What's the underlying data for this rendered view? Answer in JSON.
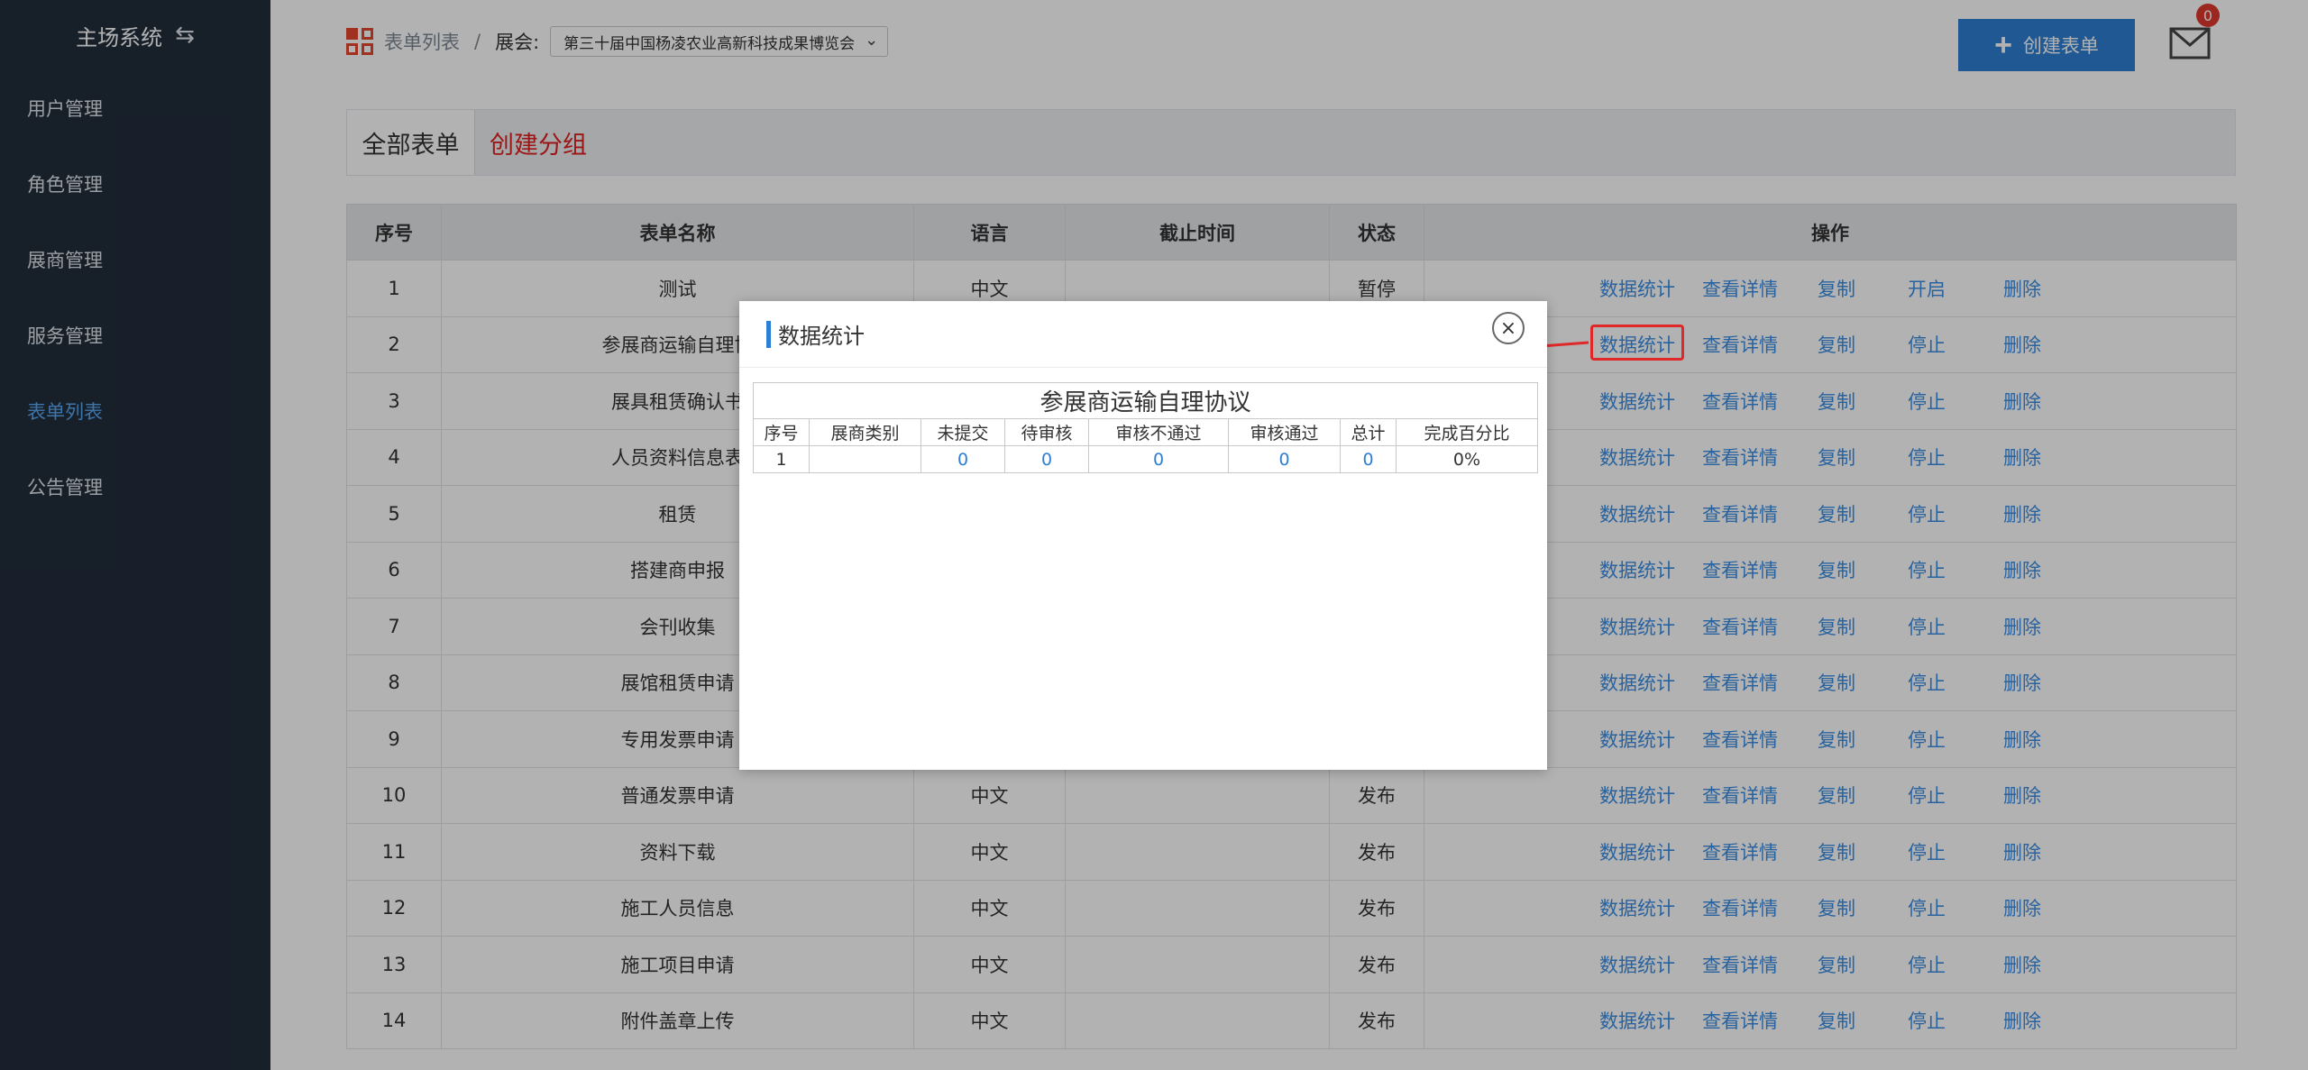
{
  "sidebar": {
    "brand": "主场系统",
    "items": [
      {
        "label": "用户管理"
      },
      {
        "label": "角色管理"
      },
      {
        "label": "展商管理"
      },
      {
        "label": "服务管理"
      },
      {
        "label": "表单列表"
      },
      {
        "label": "公告管理"
      }
    ]
  },
  "header": {
    "breadcrumb_link": "表单列表",
    "breadcrumb_sep": "/",
    "expo_label": "展会:",
    "expo_selected": "第三十届中国杨凌农业高新科技成果博览会",
    "create_button": "创建表单",
    "mail_badge": "0"
  },
  "tabs": {
    "all": "全部表单",
    "create_group": "创建分组"
  },
  "table": {
    "columns": [
      "序号",
      "表单名称",
      "语言",
      "截止时间",
      "状态",
      "操作"
    ],
    "ops": {
      "stats": "数据统计",
      "details": "查看详情",
      "copy": "复制",
      "delete": "删除"
    },
    "rows": [
      {
        "no": "1",
        "name": "测试",
        "lang": "中文",
        "deadline": "",
        "status": "暂停",
        "toggle": "开启"
      },
      {
        "no": "2",
        "name": "参展商运输自理协",
        "lang": "",
        "deadline": "",
        "status": "",
        "toggle": "停止"
      },
      {
        "no": "3",
        "name": "展具租赁确认书",
        "lang": "",
        "deadline": "",
        "status": "",
        "toggle": "停止"
      },
      {
        "no": "4",
        "name": "人员资料信息表",
        "lang": "",
        "deadline": "",
        "status": "",
        "toggle": "停止"
      },
      {
        "no": "5",
        "name": "租赁",
        "lang": "",
        "deadline": "",
        "status": "",
        "toggle": "停止"
      },
      {
        "no": "6",
        "name": "搭建商申报",
        "lang": "",
        "deadline": "",
        "status": "",
        "toggle": "停止"
      },
      {
        "no": "7",
        "name": "会刊收集",
        "lang": "",
        "deadline": "",
        "status": "",
        "toggle": "停止"
      },
      {
        "no": "8",
        "name": "展馆租赁申请",
        "lang": "",
        "deadline": "",
        "status": "",
        "toggle": "停止"
      },
      {
        "no": "9",
        "name": "专用发票申请",
        "lang": "",
        "deadline": "",
        "status": "",
        "toggle": "停止"
      },
      {
        "no": "10",
        "name": "普通发票申请",
        "lang": "中文",
        "deadline": "",
        "status": "发布",
        "toggle": "停止"
      },
      {
        "no": "11",
        "name": "资料下载",
        "lang": "中文",
        "deadline": "",
        "status": "发布",
        "toggle": "停止"
      },
      {
        "no": "12",
        "name": "施工人员信息",
        "lang": "中文",
        "deadline": "",
        "status": "发布",
        "toggle": "停止"
      },
      {
        "no": "13",
        "name": "施工项目申请",
        "lang": "中文",
        "deadline": "",
        "status": "发布",
        "toggle": "停止"
      },
      {
        "no": "14",
        "name": "附件盖章上传",
        "lang": "中文",
        "deadline": "",
        "status": "发布",
        "toggle": "停止"
      }
    ]
  },
  "modal": {
    "title": "数据统计",
    "close_glyph": "×",
    "stats_caption": "参展商运输自理协议",
    "stats_columns": [
      "序号",
      "展商类别",
      "未提交",
      "待审核",
      "审核不通过",
      "审核通过",
      "总计",
      "完成百分比"
    ],
    "stats_row": {
      "no": "1",
      "category": "",
      "unsubmitted": "0",
      "pending": "0",
      "rejected": "0",
      "approved": "0",
      "total": "0",
      "percent": "0%"
    }
  },
  "colors": {
    "sidebar_bg": "#222d3c",
    "accent_blue": "#2d7fd3",
    "link_blue": "#3a8ee6",
    "highlight_red": "#e02828"
  }
}
